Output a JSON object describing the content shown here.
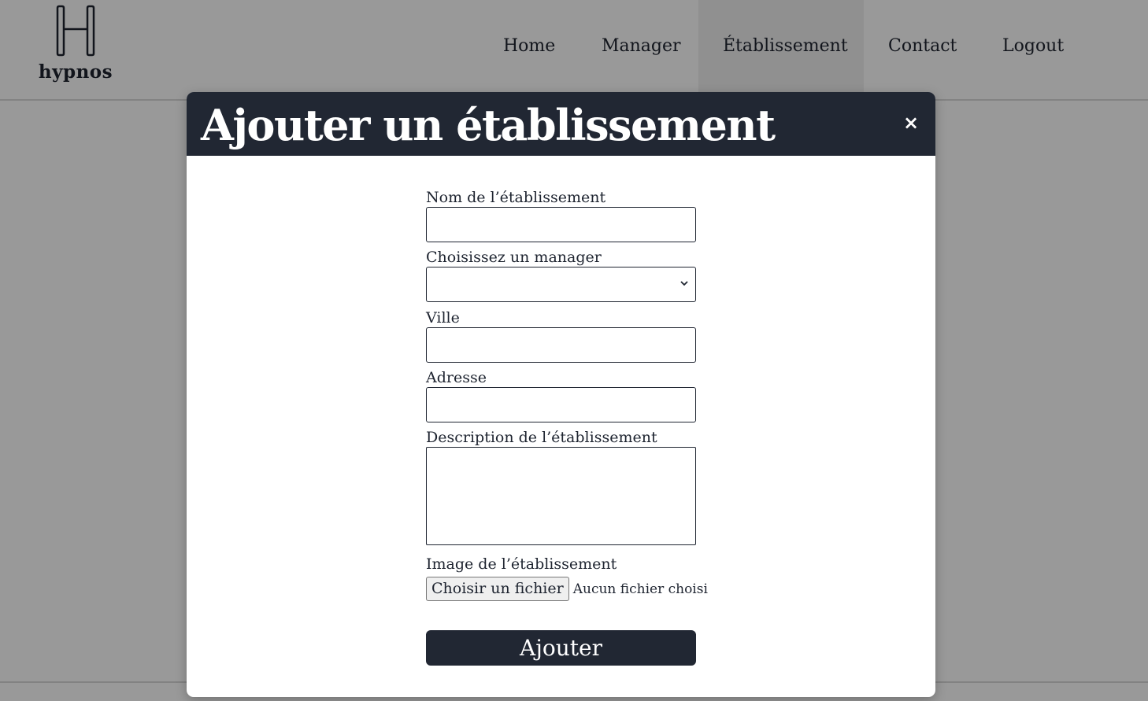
{
  "brand": {
    "name": "hypnos",
    "logo_icon": "letter-h-logo"
  },
  "nav": {
    "items": [
      {
        "label": "Home"
      },
      {
        "label": "Manager"
      },
      {
        "label": "Établissement"
      },
      {
        "label": "Contact"
      },
      {
        "label": "Logout"
      }
    ],
    "active": "Établissement"
  },
  "modal": {
    "title": "Ajouter un établissement",
    "close_label": "×",
    "fields": {
      "nom_label": "Nom de l’établissement",
      "nom_value": "",
      "manager_label": "Choisissez un manager",
      "manager_selected": "",
      "ville_label": "Ville",
      "ville_value": "",
      "adresse_label": "Adresse",
      "adresse_value": "",
      "description_label": "Description de l’établissement",
      "description_value": "",
      "image_label": "Image de l’établissement",
      "file_button_label": "Choisir un fichier",
      "file_status": "Aucun fichier choisi"
    },
    "submit_label": "Ajouter"
  },
  "colors": {
    "header_bg": "#212733",
    "button_bg": "#212733",
    "overlay": "rgba(0,0,0,0.4)"
  }
}
